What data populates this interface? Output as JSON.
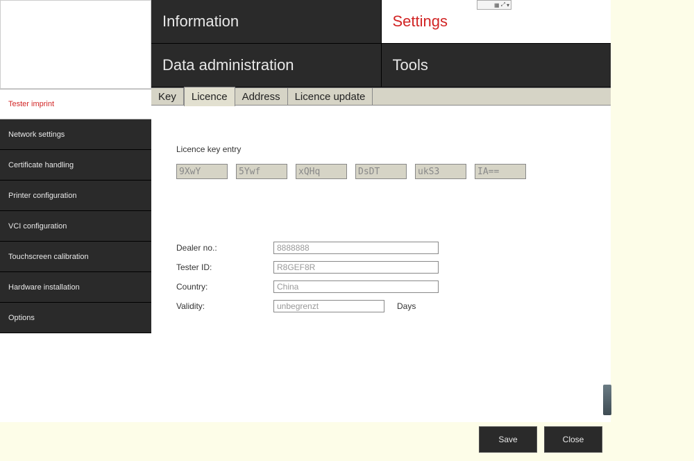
{
  "topnav": {
    "row1": {
      "left": "Information",
      "right": "Settings"
    },
    "row2": {
      "left": "Data administration",
      "right": "Tools"
    },
    "active": "Settings"
  },
  "sidebar": {
    "items": [
      {
        "label": "Tester imprint",
        "active": true
      },
      {
        "label": "Network settings",
        "active": false
      },
      {
        "label": "Certificate handling",
        "active": false
      },
      {
        "label": "Printer configuration",
        "active": false
      },
      {
        "label": "VCI configuration",
        "active": false
      },
      {
        "label": "Touchscreen calibration",
        "active": false
      },
      {
        "label": "Hardware installation",
        "active": false
      },
      {
        "label": "Options",
        "active": false
      }
    ]
  },
  "subtabs": {
    "items": [
      "Key",
      "Licence",
      "Address",
      "Licence update"
    ],
    "active": "Licence"
  },
  "licence": {
    "section_label": "Licence key entry",
    "keys": [
      "9XwY",
      "5Ywf",
      "xQHq",
      "DsDT",
      "ukS3",
      "IA=="
    ],
    "fields": {
      "dealer_label": "Dealer no.:",
      "dealer_value": "8888888",
      "tester_label": "Tester ID:",
      "tester_value": "R8GEF8R",
      "country_label": "Country:",
      "country_value": "China",
      "validity_label": "Validity:",
      "validity_value": "unbegrenzt",
      "validity_suffix": "Days"
    }
  },
  "buttons": {
    "save": "Save",
    "close": "Close"
  }
}
